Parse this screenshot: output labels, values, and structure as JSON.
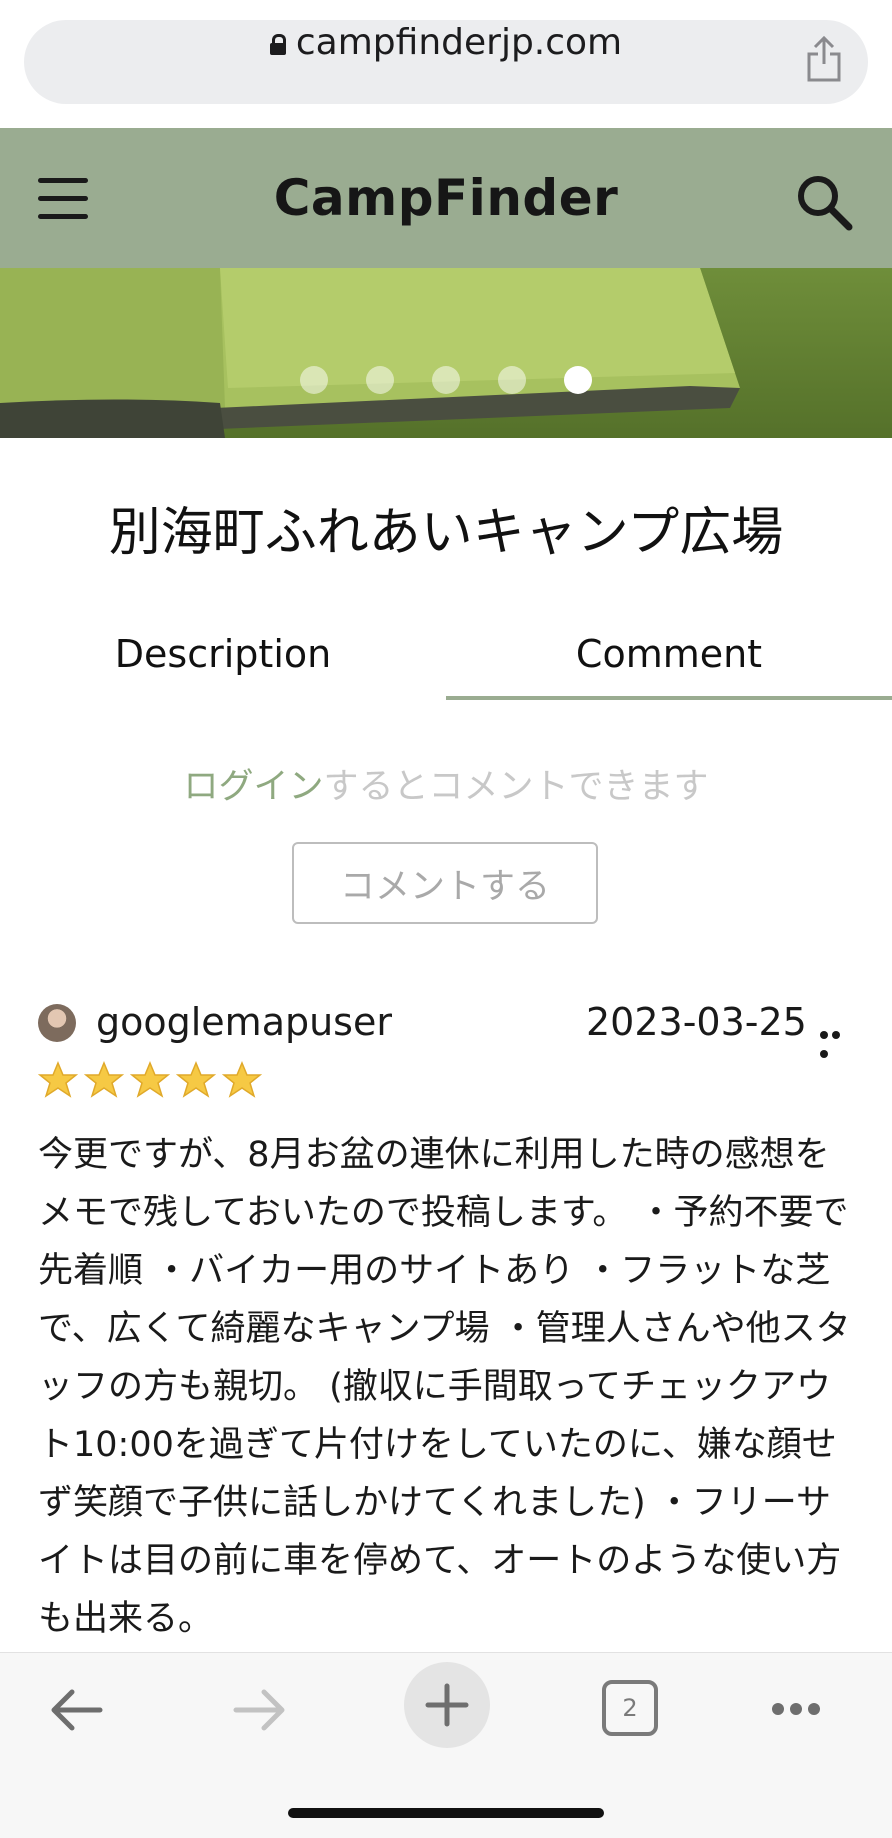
{
  "browser": {
    "url": "campfinderjp.com",
    "tab_count": "2"
  },
  "site": {
    "logo": "CampFinder"
  },
  "carousel": {
    "total_slides": 5,
    "active_index": 4
  },
  "page": {
    "title": "別海町ふれあいキャンプ広場"
  },
  "tabs": [
    {
      "label": "Description",
      "active": false
    },
    {
      "label": "Comment",
      "active": true
    }
  ],
  "comments": {
    "login_link": "ログイン",
    "login_suffix": "するとコメントできます",
    "comment_button": "コメントする"
  },
  "review": {
    "username": "googlemapuser",
    "date": "2023-03-25",
    "rating": 5,
    "text": "今更ですが、8月お盆の連休に利用した時の感想をメモで残しておいたので投稿します。 ・予約不要で先着順 ・バイカー用のサイトあり ・フラットな芝で、広くて綺麗なキャンプ場 ・管理人さんや他スタッフの方も親切。 (撤収に手間取ってチェックアウト10:00を過ぎて片付けをしていたのに、嫌な顔せず笑顔で子供に話しかけてくれました) ・フリーサイトは目の前に車を停めて、オートのような使い方も出来る。"
  },
  "colors": {
    "header_bg": "#9aac91",
    "accent": "#8fa980",
    "star": "#f6c944"
  }
}
